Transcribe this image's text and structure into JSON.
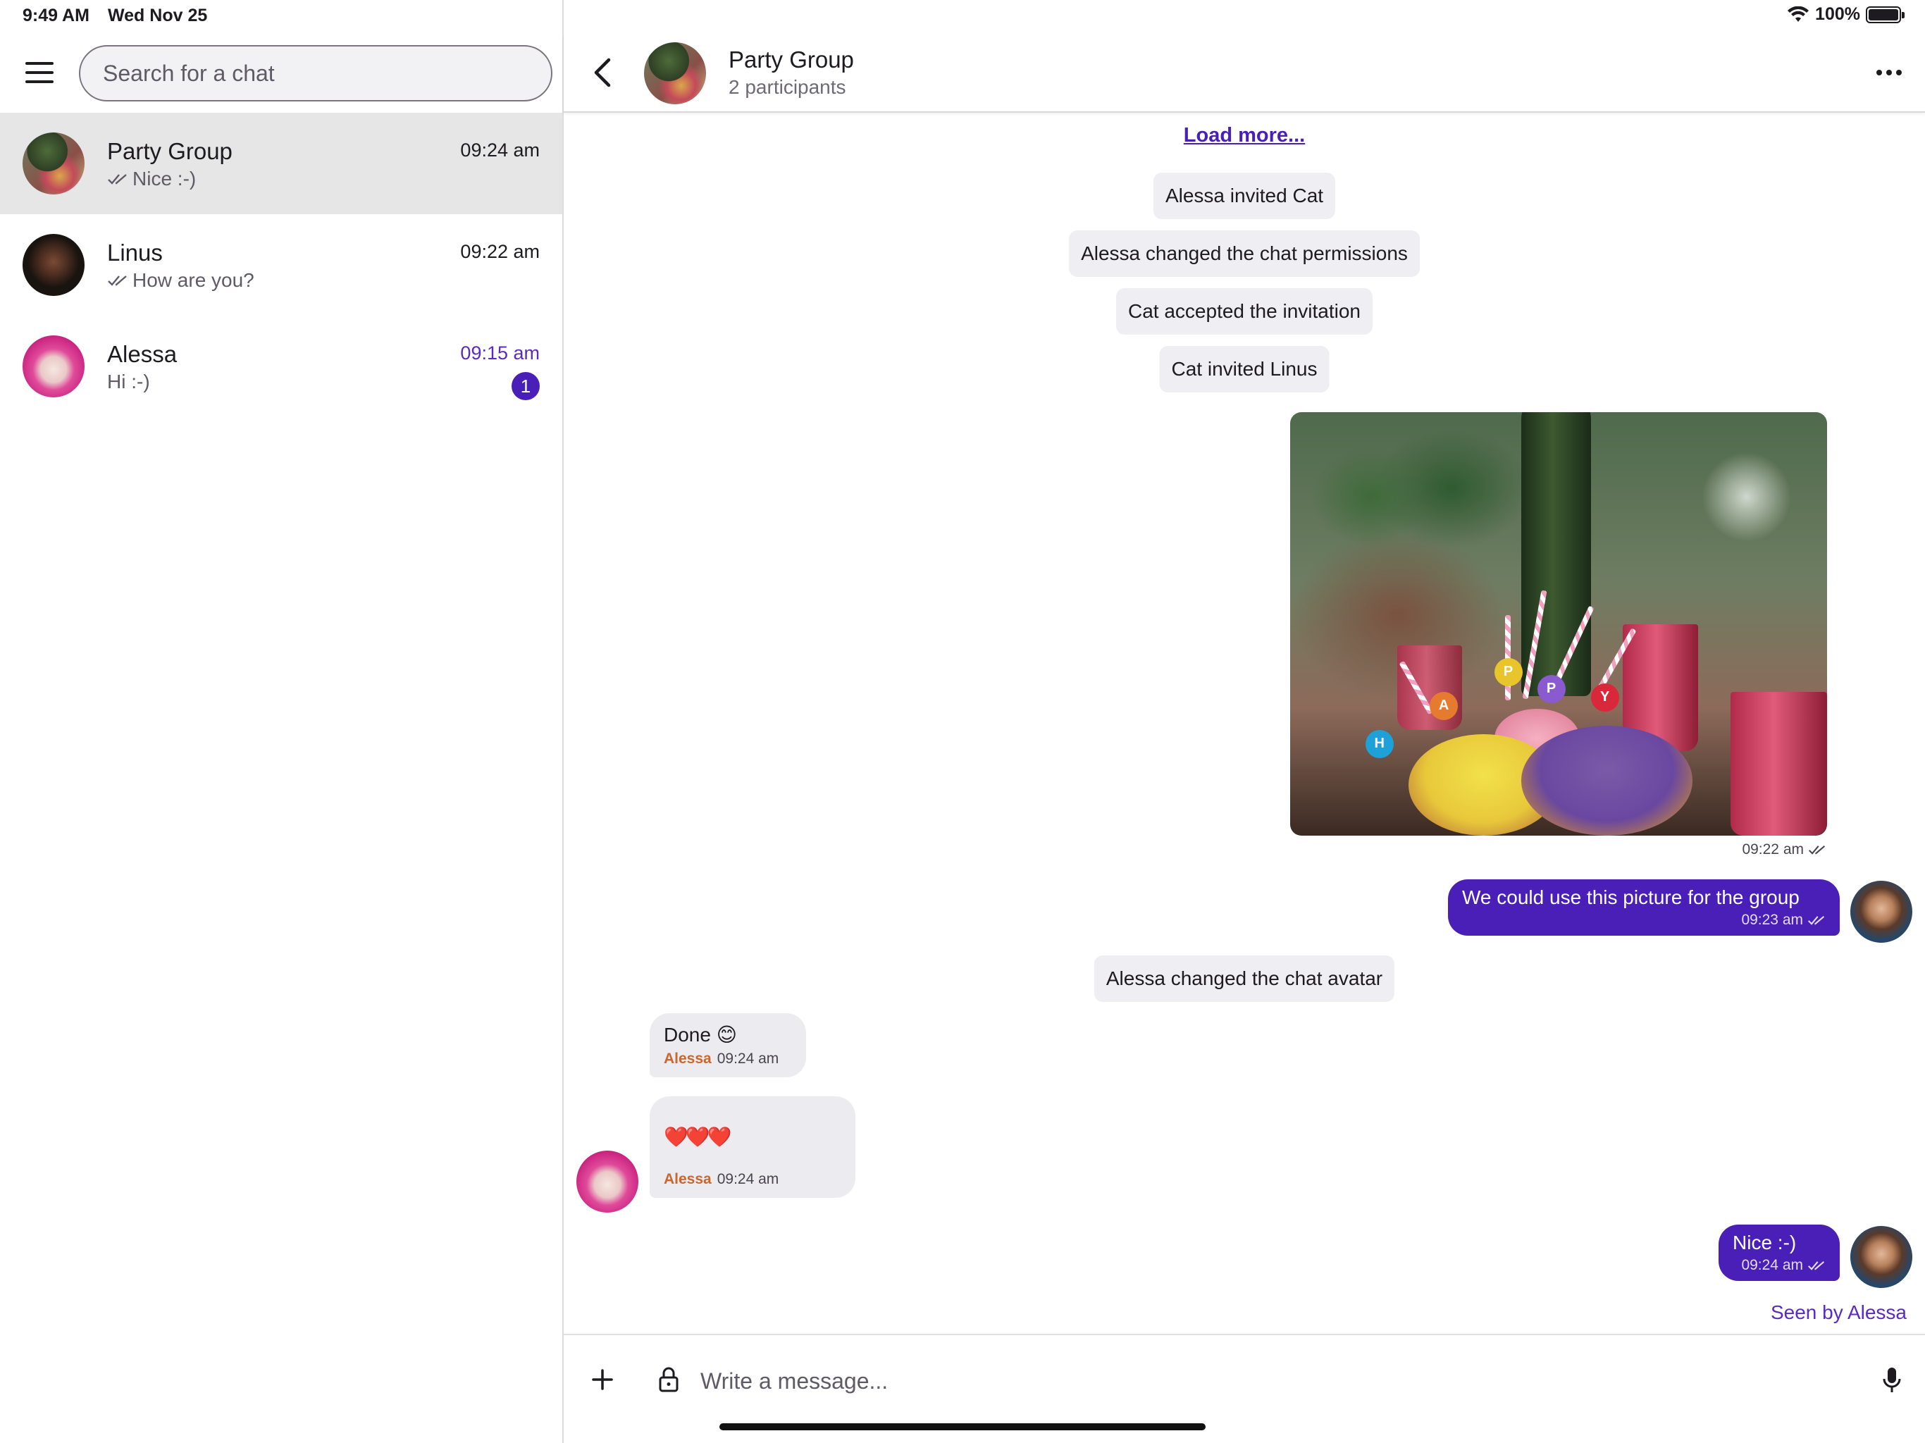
{
  "status_bar": {
    "time": "9:49 AM",
    "date": "Wed Nov 25",
    "battery": "100%",
    "icons": [
      "wifi-icon",
      "battery-icon"
    ]
  },
  "sidebar": {
    "menu_icon": "hamburger-menu-icon",
    "search": {
      "placeholder": "Search for a chat",
      "value": ""
    },
    "chats": [
      {
        "name": "Party Group",
        "preview": "Nice :-)",
        "time": "09:24 am",
        "read_receipt": true,
        "unread": null,
        "active": true
      },
      {
        "name": "Linus",
        "preview": "How are you?",
        "time": "09:22 am",
        "read_receipt": true,
        "unread": null,
        "active": false
      },
      {
        "name": "Alessa",
        "preview": "Hi :-)",
        "time": "09:15 am",
        "read_receipt": false,
        "unread": "1",
        "active": false
      }
    ]
  },
  "header": {
    "title": "Party Group",
    "subtitle": "2 participants",
    "icons": [
      "back-chevron-icon",
      "more-horizontal-icon"
    ]
  },
  "conversation": {
    "load_more": "Load more...",
    "system_events": [
      "Alessa invited Cat",
      "Alessa changed the chat permissions",
      "Cat accepted the invitation",
      "Cat invited Linus",
      "Alessa changed the chat avatar"
    ],
    "image_message": {
      "time": "09:22 am",
      "read_receipt": true
    },
    "outgoing": [
      {
        "text": "We could use this picture for the group",
        "time": "09:23 am"
      },
      {
        "text": "Nice :-)",
        "time": "09:24 am"
      }
    ],
    "incoming": [
      {
        "text": "Done 😊",
        "sender": "Alessa",
        "time": "09:24 am"
      },
      {
        "text": "❤️❤️❤️",
        "sender": "Alessa",
        "time": "09:24 am"
      }
    ],
    "seen_by": "Seen by Alessa"
  },
  "composer": {
    "placeholder": "Write a message...",
    "icons": [
      "plus-icon",
      "lock-icon",
      "microphone-icon"
    ]
  },
  "colors": {
    "accent": "#4a1fb8",
    "sender_name": "#c9672e",
    "active_row": "#e6e6e6",
    "system_pill": "#efeef2"
  }
}
